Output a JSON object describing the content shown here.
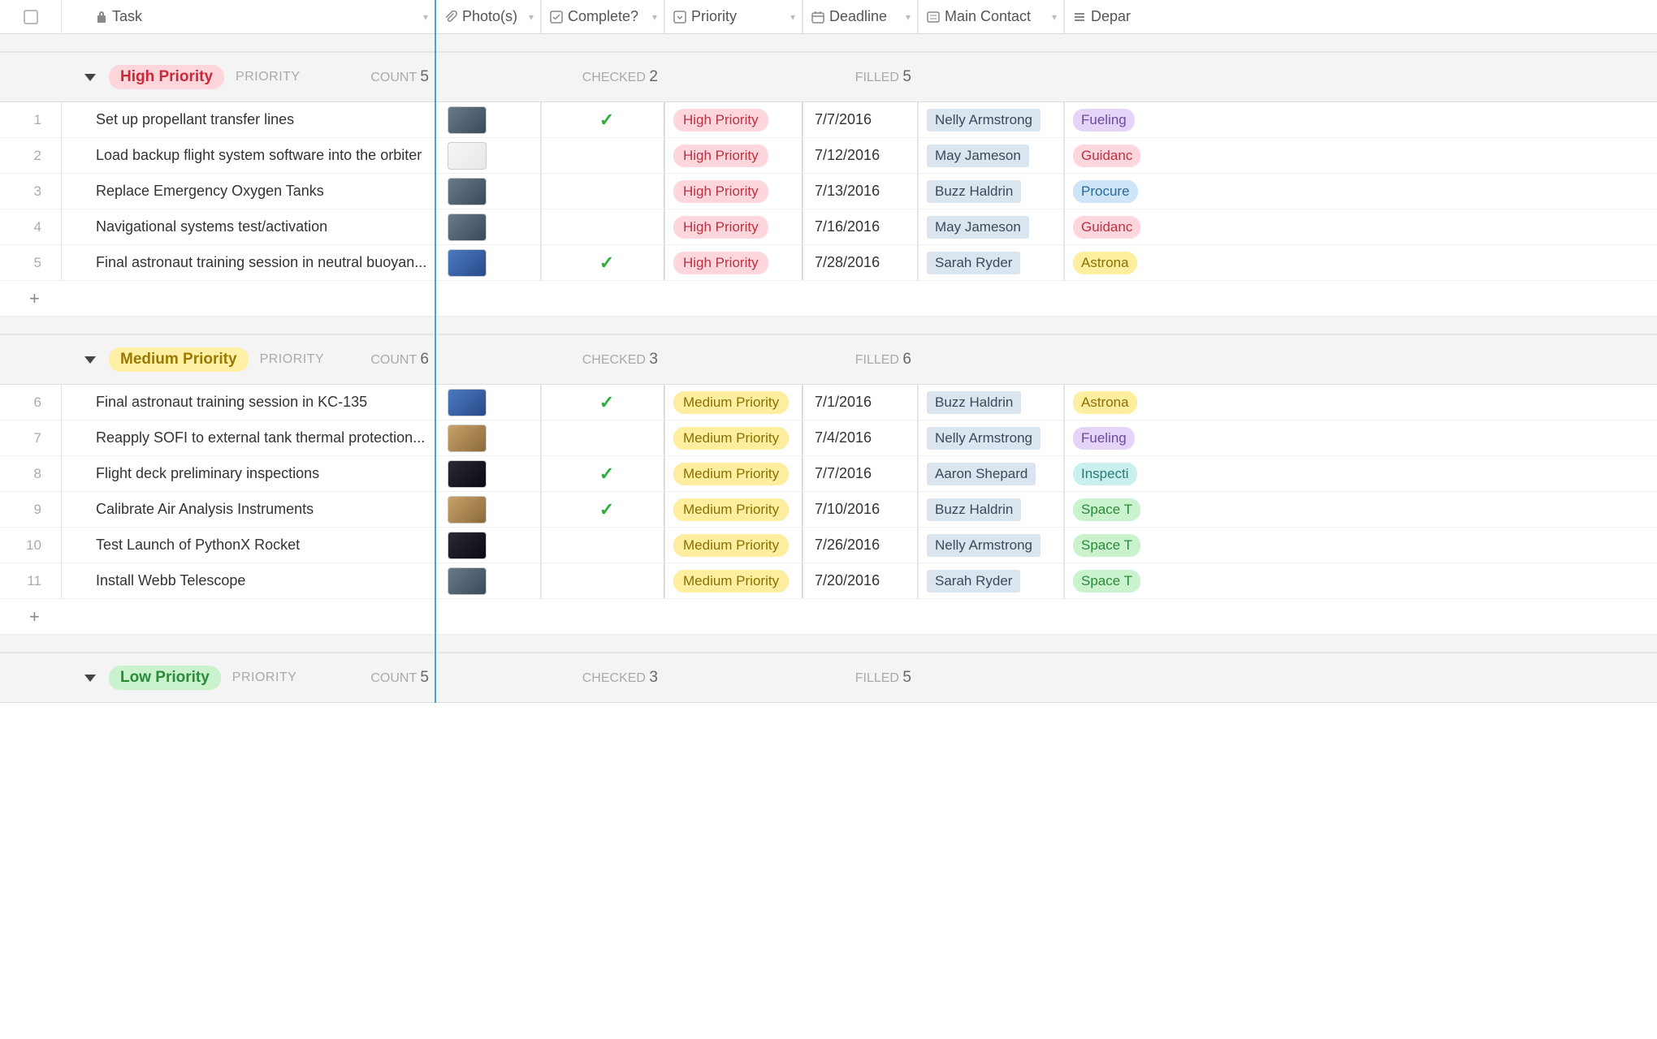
{
  "columns": {
    "task": "Task",
    "photos": "Photo(s)",
    "complete": "Complete?",
    "priority": "Priority",
    "deadline": "Deadline",
    "contact": "Main Contact",
    "department": "Depar"
  },
  "labels": {
    "priority_subtitle": "PRIORITY",
    "count_label": "COUNT",
    "checked_label": "CHECKED",
    "filled_label": "FILLED"
  },
  "groups": [
    {
      "name": "High Priority",
      "pill_class": "pill-high",
      "count": "5",
      "checked": "2",
      "filled": "5",
      "rows": [
        {
          "num": "1",
          "task": "Set up propellant transfer lines",
          "thumb": "thumb",
          "complete": true,
          "priority": "High Priority",
          "deadline": "7/7/2016",
          "contact": "Nelly Armstrong",
          "dept": "Fueling",
          "dept_class": "dept-fueling"
        },
        {
          "num": "2",
          "task": "Load backup flight system software into the orbiter",
          "thumb": "thumb light",
          "complete": false,
          "priority": "High Priority",
          "deadline": "7/12/2016",
          "contact": "May Jameson",
          "dept": "Guidanc",
          "dept_class": "dept-guidance"
        },
        {
          "num": "3",
          "task": "Replace Emergency Oxygen Tanks",
          "thumb": "thumb",
          "complete": false,
          "priority": "High Priority",
          "deadline": "7/13/2016",
          "contact": "Buzz Haldrin",
          "dept": "Procure",
          "dept_class": "dept-procure"
        },
        {
          "num": "4",
          "task": "Navigational systems test/activation",
          "thumb": "thumb",
          "complete": false,
          "priority": "High Priority",
          "deadline": "7/16/2016",
          "contact": "May Jameson",
          "dept": "Guidanc",
          "dept_class": "dept-guidance"
        },
        {
          "num": "5",
          "task": "Final astronaut training session in neutral buoyan...",
          "thumb": "thumb blue",
          "complete": true,
          "priority": "High Priority",
          "deadline": "7/28/2016",
          "contact": "Sarah Ryder",
          "dept": "Astrona",
          "dept_class": "dept-astro"
        }
      ]
    },
    {
      "name": "Medium Priority",
      "pill_class": "pill-medium",
      "count": "6",
      "checked": "3",
      "filled": "6",
      "rows": [
        {
          "num": "6",
          "task": "Final astronaut training session in KC-135",
          "thumb": "thumb blue",
          "complete": true,
          "priority": "Medium Priority",
          "deadline": "7/1/2016",
          "contact": "Buzz Haldrin",
          "dept": "Astrona",
          "dept_class": "dept-astro"
        },
        {
          "num": "7",
          "task": "Reapply SOFI to external tank thermal protection...",
          "thumb": "thumb warm",
          "complete": false,
          "priority": "Medium Priority",
          "deadline": "7/4/2016",
          "contact": "Nelly Armstrong",
          "dept": "Fueling",
          "dept_class": "dept-fueling"
        },
        {
          "num": "8",
          "task": "Flight deck preliminary inspections",
          "thumb": "thumb dark",
          "complete": true,
          "priority": "Medium Priority",
          "deadline": "7/7/2016",
          "contact": "Aaron Shepard",
          "dept": "Inspecti",
          "dept_class": "dept-inspect"
        },
        {
          "num": "9",
          "task": "Calibrate Air Analysis Instruments",
          "thumb": "thumb warm",
          "complete": true,
          "priority": "Medium Priority",
          "deadline": "7/10/2016",
          "contact": "Buzz Haldrin",
          "dept": "Space T",
          "dept_class": "dept-space"
        },
        {
          "num": "10",
          "task": "Test Launch of PythonX Rocket",
          "thumb": "thumb dark",
          "complete": false,
          "priority": "Medium Priority",
          "deadline": "7/26/2016",
          "contact": "Nelly Armstrong",
          "dept": "Space T",
          "dept_class": "dept-space"
        },
        {
          "num": "11",
          "task": "Install Webb Telescope",
          "thumb": "thumb",
          "complete": false,
          "priority": "Medium Priority",
          "deadline": "7/20/2016",
          "contact": "Sarah Ryder",
          "dept": "Space T",
          "dept_class": "dept-space"
        }
      ]
    },
    {
      "name": "Low Priority",
      "pill_class": "pill-low",
      "count": "5",
      "checked": "3",
      "filled": "5",
      "rows": []
    }
  ]
}
